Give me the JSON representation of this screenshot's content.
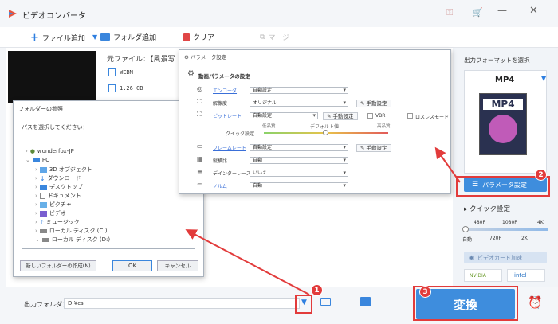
{
  "app": {
    "title": "ビデオコンバータ"
  },
  "toolbar": {
    "add_file": "ファイル追加",
    "add_folder": "フォルダ追加",
    "clear": "クリア",
    "merge": "マージ"
  },
  "file": {
    "source_label": "元ファイル：",
    "source_value": "【風景写",
    "format": "WEBM",
    "size": "1.26 GB"
  },
  "folder_dialog": {
    "title": "フォルダーの参照",
    "prompt": "パスを選択してください：",
    "tree": [
      "wonderfox-JP",
      "PC",
      "3D オブジェクト",
      "ダウンロード",
      "デスクトップ",
      "ドキュメント",
      "ピクチャ",
      "ビデオ",
      "ミュージック",
      "ローカル ディスク (C:)",
      "ローカル ディスク (D:)"
    ],
    "new_folder": "新しいフォルダーの作成(N)",
    "ok": "OK",
    "cancel": "キャンセル"
  },
  "params": {
    "window_title": "パラメータ設定",
    "section_title": "動画パラメータの設定",
    "encoder": {
      "label": "エンコーダ",
      "value": "自動設定"
    },
    "resolution": {
      "label": "解像度",
      "value": "オリジナル"
    },
    "bitrate": {
      "label": "ビットレート",
      "value": "自動設定"
    },
    "vbr": "VBR",
    "lossless": "ロスレスモード",
    "quick_label": "クイック設定",
    "low_q": "低品質",
    "default_q": "デフォルト値",
    "high_q": "高品質",
    "framerate": {
      "label": "フレームレート",
      "value": "自動設定"
    },
    "aspect": {
      "label": "縦横比",
      "value": "自動"
    },
    "deinterlace": {
      "label": "デインターレース",
      "value": "いいえ"
    },
    "volume": {
      "label": "ノルム",
      "value": "自動"
    },
    "manual": "手動設定"
  },
  "output_panel": {
    "title": "出力フォーマットを選択",
    "format": "MP4",
    "param_button": "パラメータ設定",
    "quick_title": "クイック設定",
    "ticks_top": [
      "480P",
      "1080P",
      "4K"
    ],
    "ticks_bottom": [
      "自動",
      "720P",
      "2K"
    ],
    "gpu_button": "ビデオカード加速",
    "nvidia": "NVIDIA",
    "intel": "intel"
  },
  "bottom": {
    "output_label": "出力フォルダ：",
    "output_path": "D:¥cs",
    "convert": "変換"
  },
  "badges": [
    "1",
    "2",
    "3"
  ],
  "colors": {
    "accent": "#3e8ddd",
    "annotation": "#e23b3b"
  }
}
